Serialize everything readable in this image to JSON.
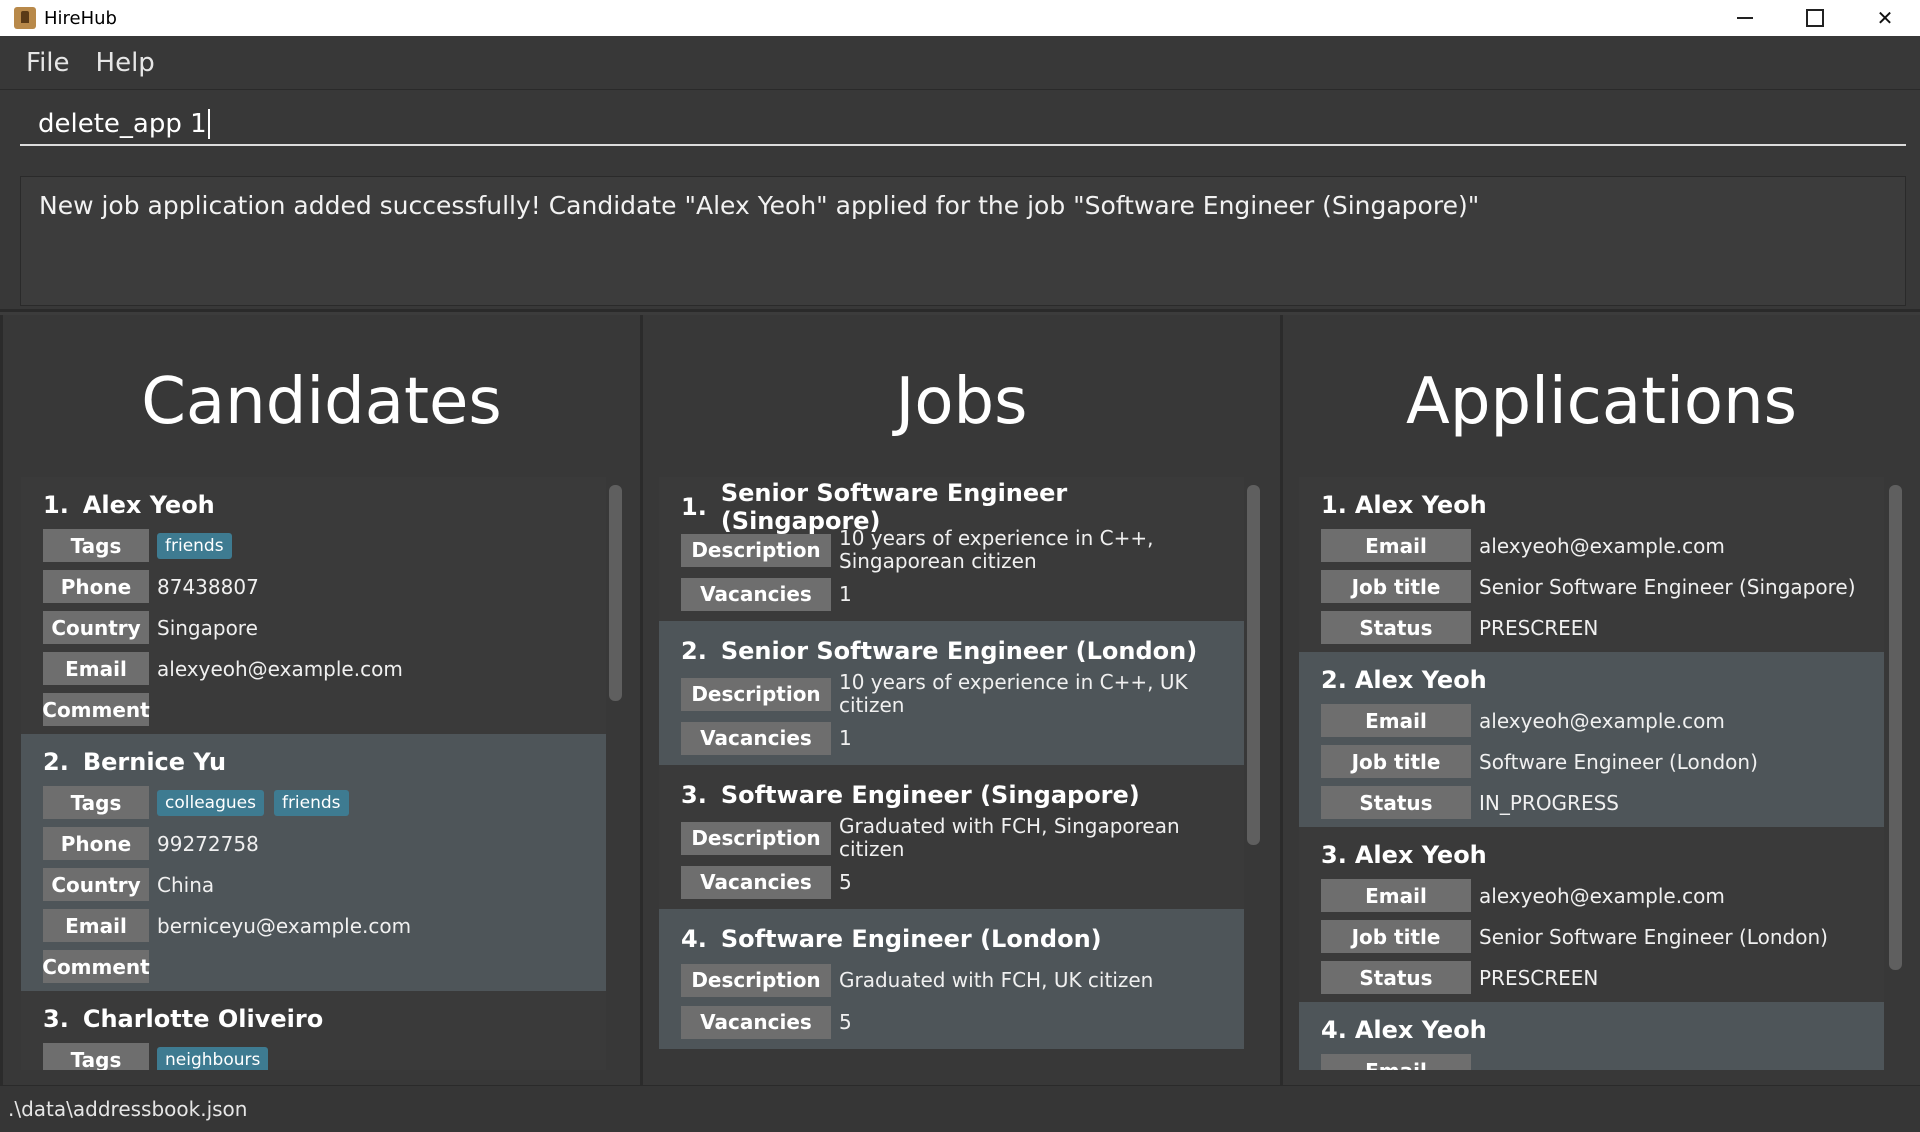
{
  "window": {
    "title": "HireHub"
  },
  "menu": {
    "file": "File",
    "help": "Help"
  },
  "command": {
    "value": "delete_app 1"
  },
  "result": {
    "message": "New job application added successfully! Candidate \"Alex Yeoh\" applied for the job \"Software Engineer (Singapore)\""
  },
  "candidates": {
    "title": "Candidates",
    "labels": {
      "tags": "Tags",
      "phone": "Phone",
      "country": "Country",
      "email": "Email",
      "comment": "Comment"
    },
    "items": [
      {
        "index": "1.",
        "name": "Alex Yeoh",
        "tags": [
          "friends"
        ],
        "phone": "87438807",
        "country": "Singapore",
        "email": "alexyeoh@example.com"
      },
      {
        "index": "2.",
        "name": "Bernice Yu",
        "tags": [
          "colleagues",
          "friends"
        ],
        "phone": "99272758",
        "country": "China",
        "email": "berniceyu@example.com"
      },
      {
        "index": "3.",
        "name": "Charlotte Oliveiro",
        "tags": [
          "neighbours"
        ],
        "phone": "",
        "country": "",
        "email": ""
      }
    ]
  },
  "jobs": {
    "title": "Jobs",
    "labels": {
      "description": "Description",
      "vacancies": "Vacancies"
    },
    "items": [
      {
        "index": "1.",
        "title": "Senior Software Engineer (Singapore)",
        "description": "10 years of experience in C++, Singaporean citizen",
        "vacancies": "1"
      },
      {
        "index": "2.",
        "title": "Senior Software Engineer (London)",
        "description": "10 years of experience in C++, UK citizen",
        "vacancies": "1"
      },
      {
        "index": "3.",
        "title": "Software Engineer (Singapore)",
        "description": "Graduated with FCH, Singaporean citizen",
        "vacancies": "5"
      },
      {
        "index": "4.",
        "title": "Software Engineer (London)",
        "description": "Graduated with FCH, UK citizen",
        "vacancies": "5"
      }
    ]
  },
  "applications": {
    "title": "Applications",
    "labels": {
      "email": "Email",
      "job_title": "Job title",
      "status": "Status"
    },
    "items": [
      {
        "index": "1.",
        "name": "Alex Yeoh",
        "email": "alexyeoh@example.com",
        "job_title": "Senior Software Engineer (Singapore)",
        "status": "PRESCREEN"
      },
      {
        "index": "2.",
        "name": "Alex Yeoh",
        "email": "alexyeoh@example.com",
        "job_title": "Software Engineer (London)",
        "status": "IN_PROGRESS"
      },
      {
        "index": "3.",
        "name": "Alex Yeoh",
        "email": "alexyeoh@example.com",
        "job_title": "Senior Software Engineer (London)",
        "status": "PRESCREEN"
      },
      {
        "index": "4.",
        "name": "Alex Yeoh",
        "email": "",
        "job_title": "",
        "status": ""
      }
    ]
  },
  "statusbar": {
    "path": ".\\data\\addressbook.json"
  }
}
